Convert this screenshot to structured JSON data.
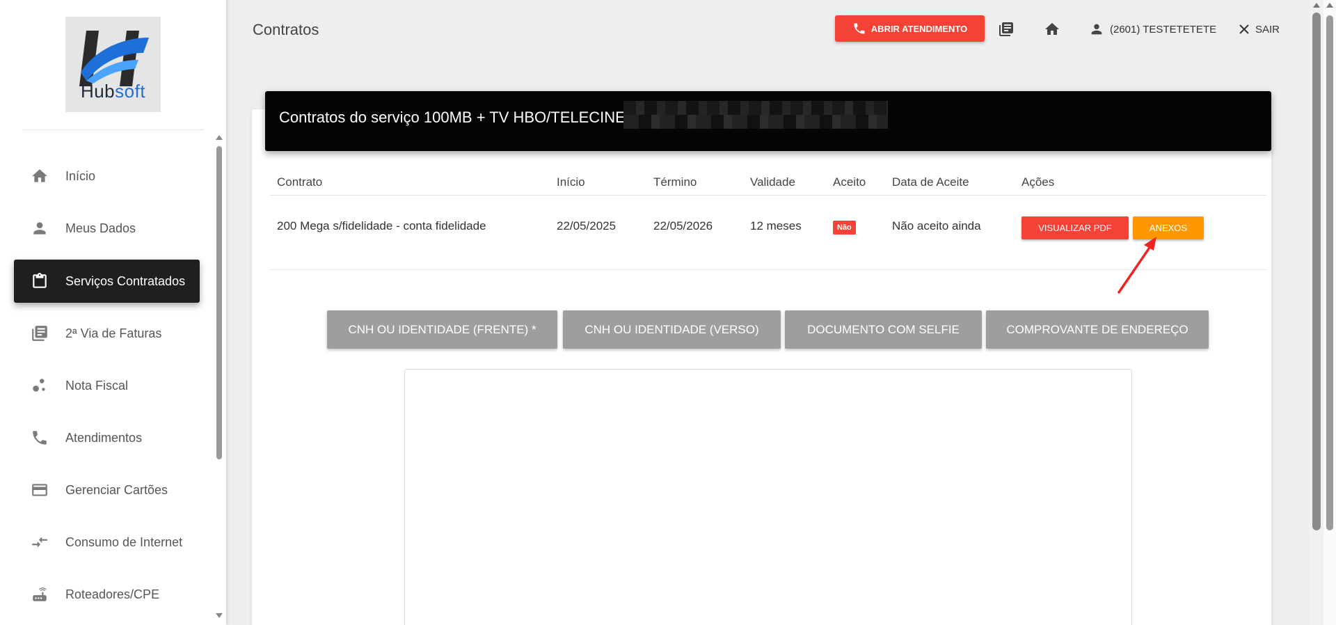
{
  "logo": {
    "text_hub": "Hub",
    "text_soft": "soft"
  },
  "header": {
    "title": "Contratos",
    "atendimento_label": "ABRIR ATENDIMENTO",
    "user_label": "(2601) TESTETETETE",
    "logout_label": "SAIR"
  },
  "sidebar": {
    "items": [
      {
        "label": "Início",
        "icon": "home-icon"
      },
      {
        "label": "Meus Dados",
        "icon": "person-icon"
      },
      {
        "label": "Serviços Contratados",
        "icon": "clipboard-icon",
        "active": true
      },
      {
        "label": "2ª Via de Faturas",
        "icon": "library-icon"
      },
      {
        "label": "Nota Fiscal",
        "icon": "bubbles-icon"
      },
      {
        "label": "Atendimentos",
        "icon": "phone-icon"
      },
      {
        "label": "Gerenciar Cartões",
        "icon": "credit-card-icon"
      },
      {
        "label": "Consumo de Internet",
        "icon": "compare-arrows-icon"
      },
      {
        "label": "Roteadores/CPE",
        "icon": "router-icon"
      }
    ]
  },
  "contracts_card": {
    "title": "Contratos do serviço 100MB + TV HBO/TELECINE",
    "columns": [
      "Contrato",
      "Início",
      "Término",
      "Validade",
      "Aceito",
      "Data de Aceite",
      "Ações"
    ],
    "rows": [
      {
        "contrato": "200 Mega s/fidelidade - conta fidelidade",
        "inicio": "22/05/2025",
        "termino": "22/05/2026",
        "validade": "12 meses",
        "aceito": "Não",
        "data_aceite": "Não aceito ainda",
        "pdf_label": "VISUALIZAR PDF",
        "anexos_label": "ANEXOS"
      }
    ]
  },
  "documents": {
    "tabs": [
      "CNH OU IDENTIDADE (FRENTE) *",
      "CNH OU IDENTIDADE (VERSO)",
      "DOCUMENTO COM SELFIE",
      "COMPROVANTE DE ENDEREÇO"
    ]
  },
  "colors": {
    "accent_red": "#f44336",
    "accent_orange": "#ff9800",
    "tab_grey": "#9e9e9e",
    "sidebar_active": "#1f1f1f"
  }
}
